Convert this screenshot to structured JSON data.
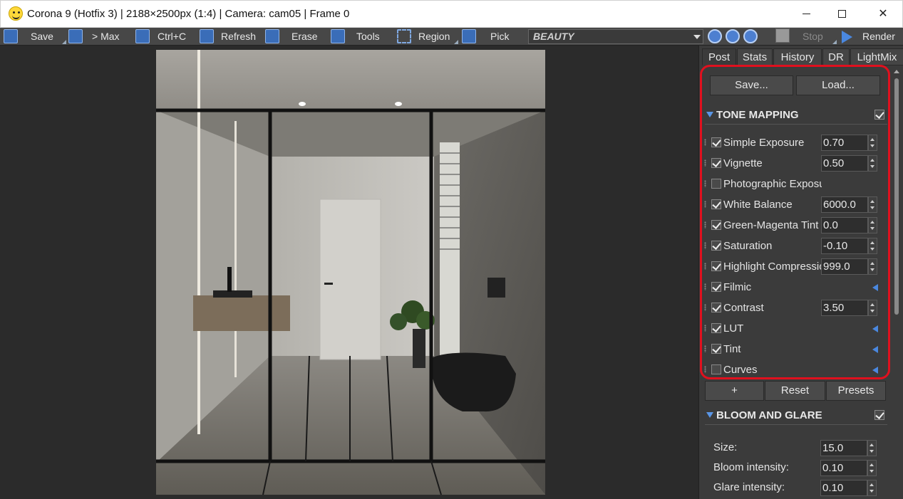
{
  "window": {
    "title": "Corona 9 (Hotfix 3) | 2188×2500px (1:4) | Camera: cam05 | Frame 0"
  },
  "toolbar": {
    "save": "Save",
    "max": "> Max",
    "copy": "Ctrl+C",
    "refresh": "Refresh",
    "erase": "Erase",
    "tools": "Tools",
    "region": "Region",
    "pick": "Pick",
    "pass": "BEAUTY",
    "stop": "Stop",
    "render": "Render"
  },
  "panel": {
    "tabs": [
      "Post",
      "Stats",
      "History",
      "DR",
      "LightMix"
    ],
    "active_tab": "Post",
    "save_button": "Save...",
    "load_button": "Load...",
    "tone_mapping": {
      "title": "TONE MAPPING",
      "enabled": true,
      "rows": [
        {
          "label": "Simple Exposure",
          "checked": true,
          "value": "0.70"
        },
        {
          "label": "Vignette",
          "checked": true,
          "value": "0.50"
        },
        {
          "label": "Photographic Exposure",
          "checked": false,
          "value": null
        },
        {
          "label": "White Balance",
          "checked": true,
          "value": "6000.0"
        },
        {
          "label": "Green-Magenta Tint",
          "checked": true,
          "value": "0.0"
        },
        {
          "label": "Saturation",
          "checked": true,
          "value": "-0.10"
        },
        {
          "label": "Highlight Compression",
          "checked": true,
          "value": "999.0"
        },
        {
          "label": "Filmic",
          "checked": true,
          "value": null,
          "expander": true
        },
        {
          "label": "Contrast",
          "checked": true,
          "value": "3.50"
        },
        {
          "label": "LUT",
          "checked": true,
          "value": null,
          "expander": true
        },
        {
          "label": "Tint",
          "checked": true,
          "value": null,
          "expander": true
        },
        {
          "label": "Curves",
          "checked": false,
          "value": null,
          "expander": true
        }
      ]
    },
    "operator_buttons": {
      "add": "+",
      "reset": "Reset",
      "presets": "Presets"
    },
    "bloom_glare": {
      "title": "BLOOM AND GLARE",
      "enabled": true,
      "rows": [
        {
          "label": "Size:",
          "value": "15.0"
        },
        {
          "label": "Bloom intensity:",
          "value": "0.10"
        },
        {
          "label": "Glare intensity:",
          "value": "0.10"
        }
      ]
    }
  },
  "colors": {
    "accent": "#4a88e0",
    "highlight": "#e0101e",
    "panel_bg": "#3b3b3b"
  }
}
